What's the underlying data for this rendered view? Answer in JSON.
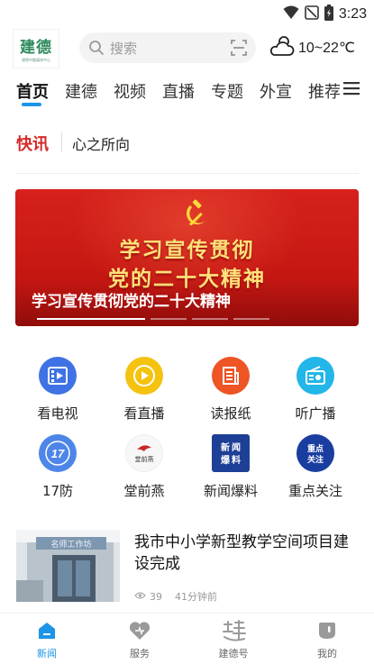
{
  "status_bar": {
    "time": "3:23"
  },
  "header": {
    "logo_main": "建德",
    "logo_sub": "建德市融媒体中心",
    "search_placeholder": "搜索",
    "weather": "10~22℃"
  },
  "tabs": [
    "首页",
    "建德",
    "视频",
    "直播",
    "专题",
    "外宣",
    "推荐"
  ],
  "flash": {
    "label": "快讯",
    "text": "心之所向"
  },
  "banner": {
    "line1": "学习宣传贯彻",
    "line2": "党的二十大精神",
    "caption": "学习宣传贯彻党的二十大精神"
  },
  "quick_links": [
    {
      "label": "看电视",
      "icon": "tv-icon",
      "color": "#3f73e5"
    },
    {
      "label": "看直播",
      "icon": "play-icon",
      "color": "#f4c20f"
    },
    {
      "label": "读报纸",
      "icon": "newspaper-icon",
      "color": "#ee5424"
    },
    {
      "label": "听广播",
      "icon": "radio-icon",
      "color": "#23b6e8"
    },
    {
      "label": "17防",
      "icon": "17fang-icon",
      "icon_text": "17"
    },
    {
      "label": "堂前燕",
      "icon": "tangqianyan-icon",
      "icon_text": "堂前燕"
    },
    {
      "label": "新闻爆料",
      "icon": "news-tip-icon",
      "icon_text": "新闻爆料"
    },
    {
      "label": "重点关注",
      "icon": "focus-icon",
      "icon_text": "重点关注"
    }
  ],
  "news": {
    "title": "我市中小学新型教学空间项目建设完成",
    "views": "39",
    "time": "41分钟前",
    "thumb_sign": "名师工作坊"
  },
  "bottom_nav": [
    "新闻",
    "服务",
    "建德号",
    "我的"
  ],
  "colors": {
    "accent": "#1c95e8",
    "flash_red": "#d62a2a",
    "banner_red": "#c81813"
  }
}
